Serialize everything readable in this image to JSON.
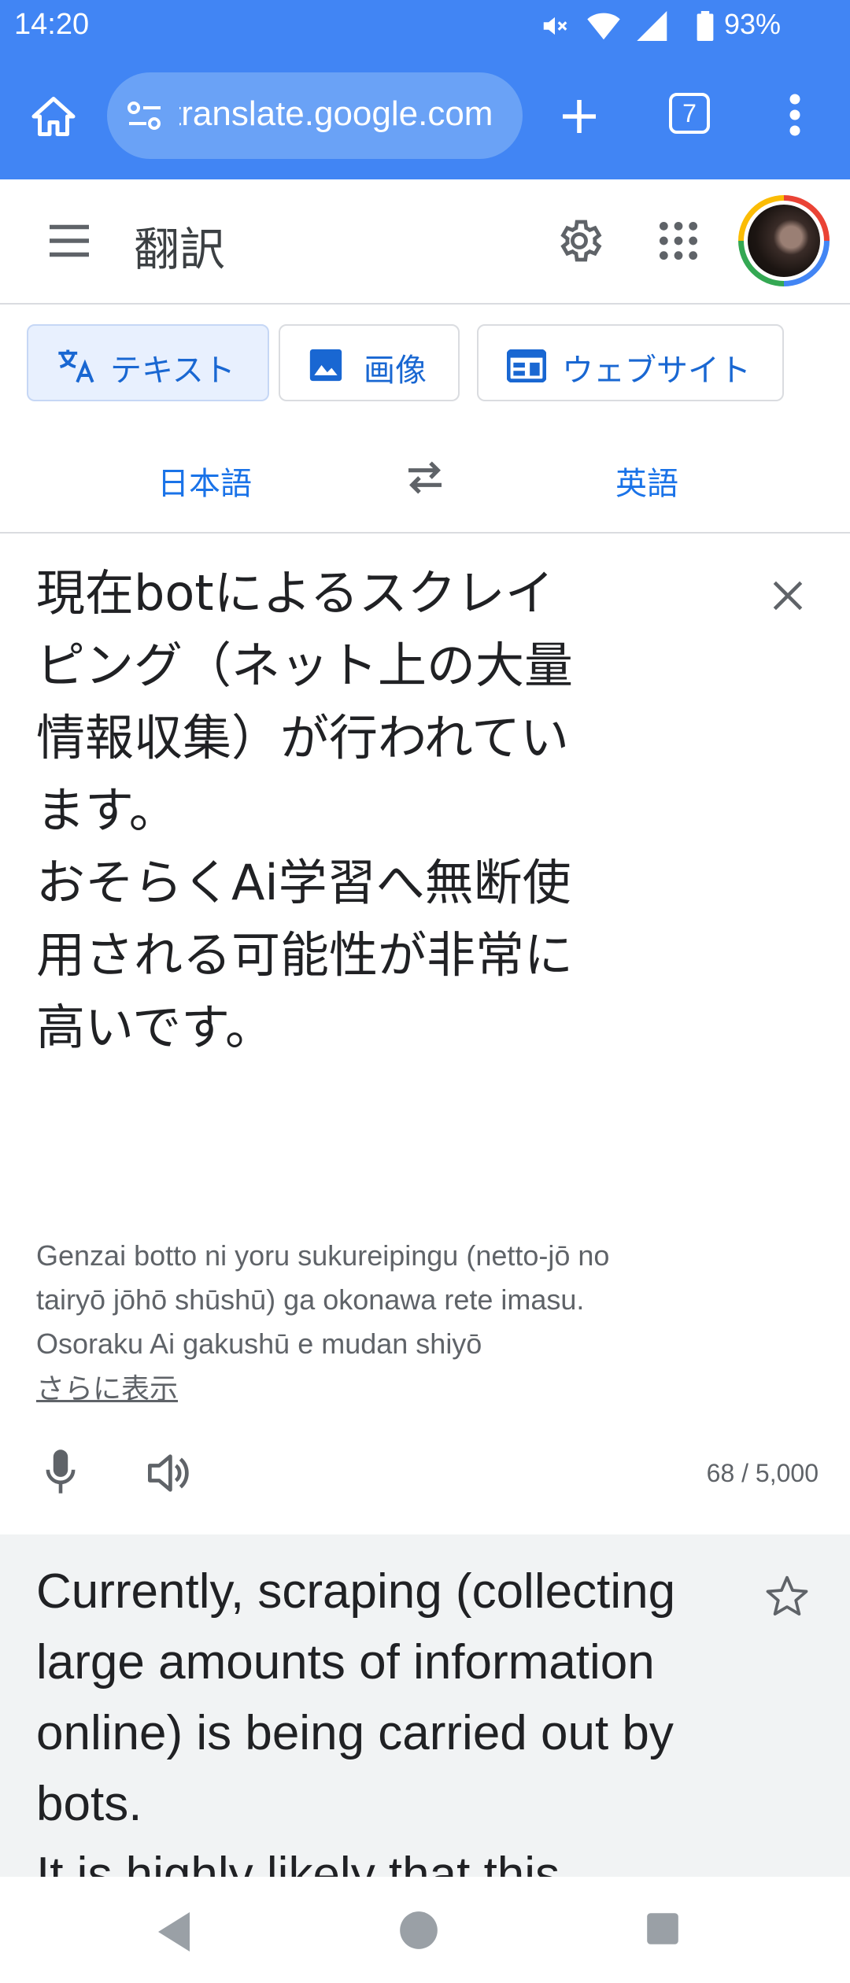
{
  "status_bar": {
    "time": "14:20",
    "battery": "93%",
    "icons": [
      "mute-icon",
      "wifi-icon",
      "cell-signal-icon",
      "battery-icon"
    ]
  },
  "browser": {
    "url": "translate.google.com",
    "tab_count": "7",
    "icons": [
      "home-icon",
      "site-info-icon",
      "new-tab-icon",
      "tab-switcher-icon",
      "more-icon"
    ]
  },
  "app": {
    "title": "翻訳",
    "icons": [
      "menu-icon",
      "settings-icon",
      "apps-grid-icon",
      "avatar"
    ]
  },
  "modes": [
    {
      "label": "テキスト",
      "icon": "translate-icon",
      "active": true
    },
    {
      "label": "画像",
      "icon": "image-icon",
      "active": false
    },
    {
      "label": "ウェブサイト",
      "icon": "website-icon",
      "active": false
    }
  ],
  "languages": {
    "source": "日本語",
    "target": "英語",
    "swap_icon": "swap-icon"
  },
  "source": {
    "text": "現在botによるスクレイ\nピング（ネット上の大量\n情報収集）が行われてい\nます。\nおそらくAi学習へ無断使\n用される可能性が非常に\n高いです。",
    "transliteration": "Genzai botto ni yoru sukureipingu (netto-jō no tairyō jōhō shūshū) ga okonawa rete imasu. Osoraku Ai gakushū e mudan shiyō",
    "show_more": "さらに表示",
    "char_count": "68 / 5,000",
    "icons": [
      "clear-icon",
      "mic-icon",
      "speaker-icon"
    ]
  },
  "translation": {
    "text": "Currently, scraping (collecting\nlarge amounts of information\nonline) is being carried out by\nbots.\nIt is highly likely that this",
    "icons": [
      "star-icon"
    ]
  },
  "nav": {
    "icons": [
      "back-icon",
      "home-nav-icon",
      "recents-icon"
    ]
  },
  "colors": {
    "brand_blue": "#4185f4",
    "accent": "#1a73e8",
    "panel_gray": "#f1f3f4"
  }
}
